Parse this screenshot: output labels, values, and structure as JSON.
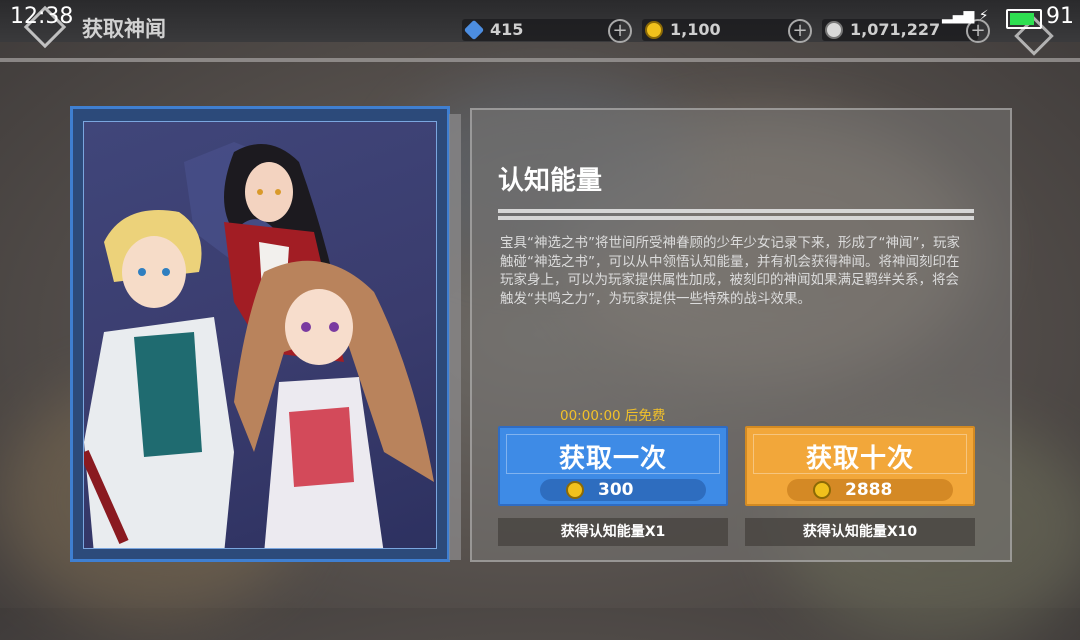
{
  "status_bar": {
    "time": "12:38",
    "battery": "91"
  },
  "header": {
    "title": "获取神闻"
  },
  "currencies": [
    {
      "icon": "diamond-icon",
      "value": "415"
    },
    {
      "icon": "gold-coin-icon",
      "value": "1,100"
    },
    {
      "icon": "silver-coin-icon",
      "value": "1,071,227"
    }
  ],
  "panel": {
    "title": "认知能量",
    "description": "宝具“神选之书”将世间所受神眷顾的少年少女记录下来，形成了“神闻”，玩家触碰“神选之书”，可以从中领悟认知能量，并有机会获得神闻。将神闻刻印在玩家身上，可以为玩家提供属性加成，被刻印的神闻如果满足羁绊关系，将会触发“共鸣之力”，为玩家提供一些特殊的战斗效果。",
    "free_timer": "00:00:00 后免费"
  },
  "buttons": {
    "single": {
      "label": "获取一次",
      "cost": "300",
      "reward": "获得认知能量X1"
    },
    "ten": {
      "label": "获取十次",
      "cost": "2888",
      "reward": "获得认知能量X10"
    }
  },
  "colors": {
    "blue_button": "#3e8be6",
    "orange_button": "#f2a73a",
    "timer": "#f2c12a"
  }
}
